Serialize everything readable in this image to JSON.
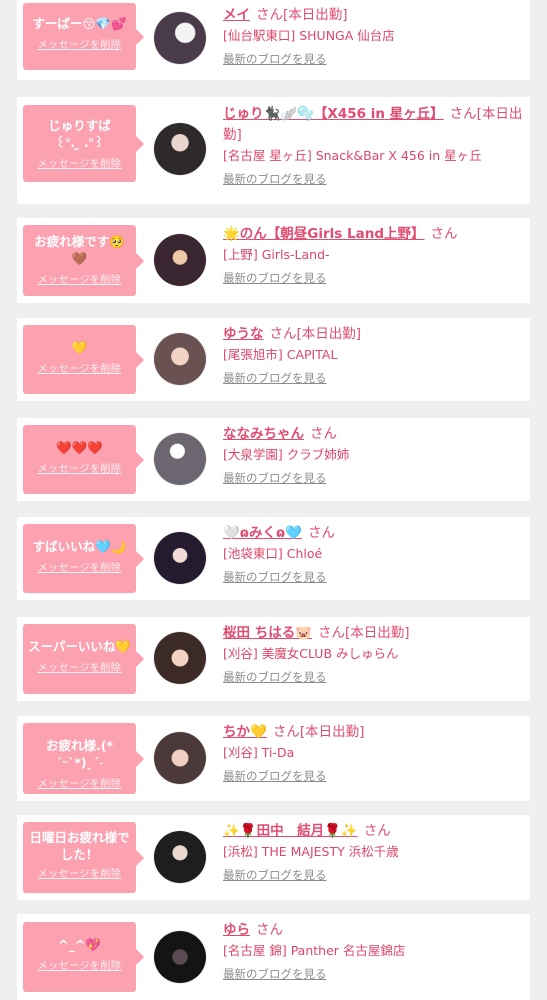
{
  "delete_label": "メッセージを削除",
  "blog_label": "最新のブログを見る",
  "san": "さん",
  "entries": [
    {
      "message": "すーぱー😚💎💕",
      "name": "メイ",
      "status": "[本日出勤]",
      "shop": "[仙台駅東口] SHUNGA 仙台店",
      "avatar_color": "#3a2c3a"
    },
    {
      "message": "じゅりすば\n꒰ᐡ. ̫ .ᐡ꒱",
      "name": "じゅり🐈‍⬛🪽🫧【X456 in 星ヶ丘】",
      "status": "[本日出勤]",
      "shop": "[名古屋 星ヶ丘] Snack&Bar X 456 in 星ヶ丘",
      "avatar_color": "#2b2b2b"
    },
    {
      "message": "お疲れ様です🥺\n🤎",
      "name": "🌟のん【朝昼Girls Land上野】",
      "status": "",
      "shop": "[上野] Girls-Land-",
      "avatar_color": "#2a1c22"
    },
    {
      "message": "💛",
      "name": "ゆうな",
      "status": "[本日出勤]",
      "shop": "[尾張旭市] CAPITAL",
      "avatar_color": "#4a3a3a"
    },
    {
      "message": "❤️❤️❤️",
      "name": "ななみちゃん",
      "status": "",
      "shop": "[大泉学園] クラブ姉姉",
      "avatar_color": "#5a5560"
    },
    {
      "message": "すばいいね🩵🌙",
      "name": "🤍ɷみくɷ🩵",
      "status": "",
      "shop": "[池袋東口] Chloé",
      "avatar_color": "#1e1a28"
    },
    {
      "message": "スーパーいいね💛",
      "name": "桜田 ちはる🐷",
      "status": "[本日出勤]",
      "shop": "[刈谷] 美魔女CLUB みしゅらん",
      "avatar_color": "#3a2a28"
    },
    {
      "message": "お疲れ様.(*´ᵕ`*)ˎˊ˗",
      "name": "ちか💛",
      "status": "[本日出勤]",
      "shop": "[刈谷] Ti-Da",
      "avatar_color": "#4a3c3c"
    },
    {
      "message": "日曜日お疲れ様で\nした！",
      "name": "✨🌹田中　結月🌹✨",
      "status": "",
      "shop": "[浜松] THE MAJESTY 浜松千歳",
      "avatar_color": "#222222"
    },
    {
      "message": "^_^💖",
      "name": "ゆら",
      "status": "",
      "shop": "[名古屋 錦] Panther 名古屋錦店",
      "avatar_color": "#1c1c1c"
    }
  ]
}
